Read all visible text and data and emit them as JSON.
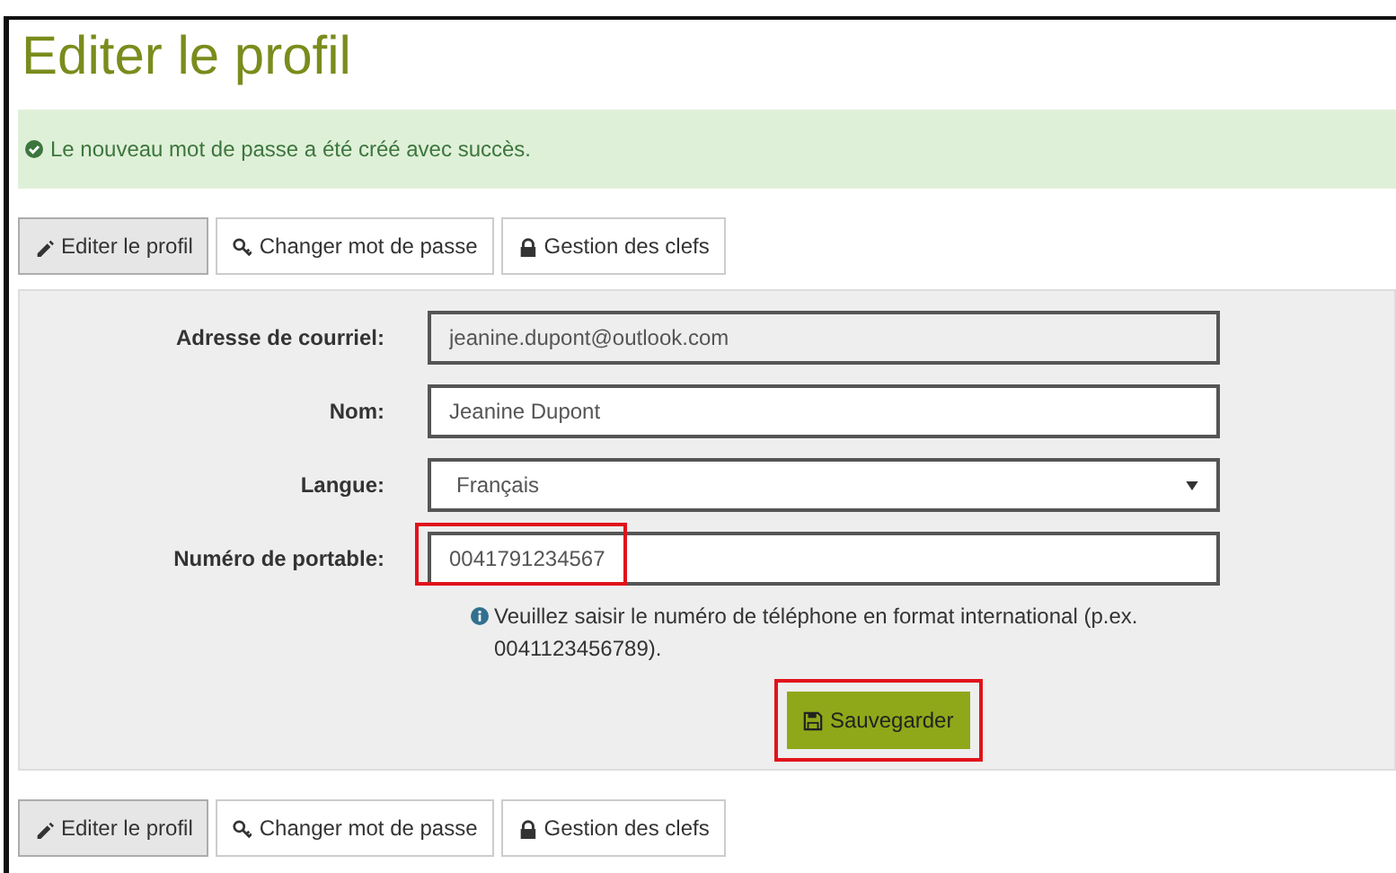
{
  "title": "Editer le profil",
  "alert": {
    "message": "Le nouveau mot de passe a été créé avec succès."
  },
  "tabs_top": [
    {
      "label": "Editer le profil",
      "selected": true
    },
    {
      "label": "Changer mot de passe",
      "selected": false
    },
    {
      "label": "Gestion des clefs",
      "selected": false
    }
  ],
  "form": {
    "fields": [
      {
        "label": "Adresse de courriel:",
        "kind": "readonly",
        "value": "jeanine.dupont@outlook.com",
        "highlighted": false
      },
      {
        "label": "Nom:",
        "kind": "text",
        "value": "Jeanine Dupont",
        "highlighted": false
      },
      {
        "label": "Langue:",
        "kind": "select",
        "value": "Français",
        "highlighted": false
      },
      {
        "label": "Numéro de portable:",
        "kind": "text",
        "value": "0041791234567",
        "highlighted": true
      }
    ],
    "help": "Veuillez saisir le numéro de téléphone en format international (p.ex. 0041123456789).",
    "save_button": {
      "label": "Sauvegarder",
      "highlighted": true
    }
  },
  "tabs_bottom": [
    {
      "label": "Editer le profil",
      "selected": true
    },
    {
      "label": "Changer mot de passe",
      "selected": false
    },
    {
      "label": "Gestion des clefs",
      "selected": false
    }
  ]
}
